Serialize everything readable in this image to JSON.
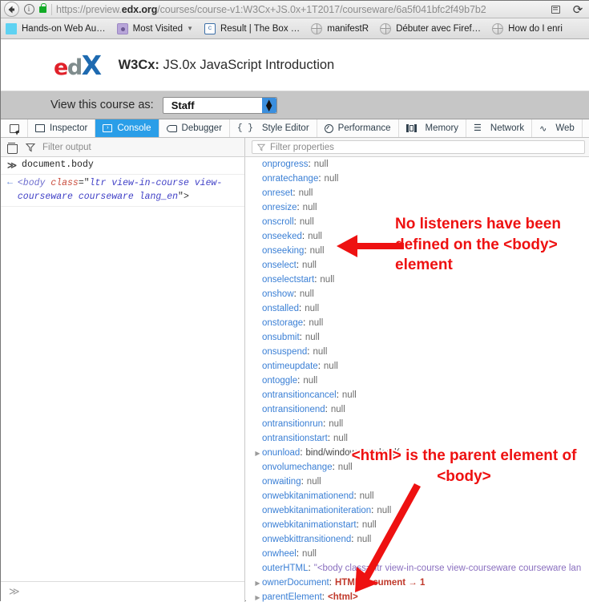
{
  "browser": {
    "url_prefix": "https://preview.",
    "url_domain": "edx.org",
    "url_rest": "/courses/course-v1:W3Cx+JS.0x+1T2017/courseware/6a5f041bfc2f49b7b2",
    "back_icon": "back-arrow-icon",
    "info_icon": "info-icon",
    "lock_icon": "secure-lock-icon",
    "reader_icon": "reader-mode-icon",
    "reload_icon": "reload-icon",
    "reload_glyph": "⟳",
    "info_glyph": "i"
  },
  "bookmarks": [
    {
      "label": "Hands-on Web Au…",
      "icon": "blue-square-icon",
      "has_caret": false
    },
    {
      "label": "Most Visited",
      "icon": "folder-icon",
      "has_caret": true
    },
    {
      "label": "Result | The Box …",
      "icon": "codepen-icon",
      "has_caret": false
    },
    {
      "label": "manifestR",
      "icon": "globe-icon",
      "has_caret": false
    },
    {
      "label": "Débuter avec Firef…",
      "icon": "globe-icon",
      "has_caret": false
    },
    {
      "label": "How do I enri",
      "icon": "globe-icon",
      "has_caret": false
    }
  ],
  "edx": {
    "logo_e": "e",
    "logo_d": "d",
    "logo_x": "X",
    "course_code": "W3Cx:",
    "course_name": " JS.0x JavaScript Introduction"
  },
  "viewas": {
    "label": "View this course as:",
    "selected": "Staff",
    "up_glyph": "▲",
    "down_glyph": "▼"
  },
  "devtools": {
    "picker_icon": "element-picker-icon",
    "tabs": [
      {
        "label": "Inspector",
        "icon": "inspector-icon",
        "active": false
      },
      {
        "label": "Console",
        "icon": "console-icon",
        "active": true
      },
      {
        "label": "Debugger",
        "icon": "debugger-icon",
        "active": false
      },
      {
        "label": "Style Editor",
        "icon": "style-editor-icon",
        "active": false
      },
      {
        "label": "Performance",
        "icon": "performance-icon",
        "active": false
      },
      {
        "label": "Memory",
        "icon": "memory-icon",
        "active": false
      },
      {
        "label": "Network",
        "icon": "network-icon",
        "active": false
      },
      {
        "label": "Web",
        "icon": "web-audio-icon",
        "active": false
      }
    ],
    "style_editor_glyph": "{ }",
    "network_glyph": "☰",
    "audio_glyph": "∿",
    "console_glyph": "›",
    "clear_icon": "trash-icon",
    "filter_output_placeholder": "Filter output",
    "filter_properties_placeholder": "Filter properties"
  },
  "console": {
    "input_marker": "≫",
    "input_text": "document.body",
    "output_marker": "←",
    "output_tag_open": "<body ",
    "output_attr": "class",
    "output_eq": "=\"",
    "output_value": "ltr view-in-course view-courseware courseware  lang_en",
    "output_tag_close": "\">",
    "prompt_marker": "≫"
  },
  "properties": [
    {
      "name": "onprogress",
      "value": "null",
      "kind": "null",
      "expandable": false
    },
    {
      "name": "onratechange",
      "value": "null",
      "kind": "null",
      "expandable": false
    },
    {
      "name": "onreset",
      "value": "null",
      "kind": "null",
      "expandable": false
    },
    {
      "name": "onresize",
      "value": "null",
      "kind": "null",
      "expandable": false
    },
    {
      "name": "onscroll",
      "value": "null",
      "kind": "null",
      "expandable": false
    },
    {
      "name": "onseeked",
      "value": "null",
      "kind": "null",
      "expandable": false
    },
    {
      "name": "onseeking",
      "value": "null",
      "kind": "null",
      "expandable": false
    },
    {
      "name": "onselect",
      "value": "null",
      "kind": "null",
      "expandable": false
    },
    {
      "name": "onselectstart",
      "value": "null",
      "kind": "null",
      "expandable": false
    },
    {
      "name": "onshow",
      "value": "null",
      "kind": "null",
      "expandable": false
    },
    {
      "name": "onstalled",
      "value": "null",
      "kind": "null",
      "expandable": false
    },
    {
      "name": "onstorage",
      "value": "null",
      "kind": "null",
      "expandable": false
    },
    {
      "name": "onsubmit",
      "value": "null",
      "kind": "null",
      "expandable": false
    },
    {
      "name": "onsuspend",
      "value": "null",
      "kind": "null",
      "expandable": false
    },
    {
      "name": "ontimeupdate",
      "value": "null",
      "kind": "null",
      "expandable": false
    },
    {
      "name": "ontoggle",
      "value": "null",
      "kind": "null",
      "expandable": false
    },
    {
      "name": "ontransitioncancel",
      "value": "null",
      "kind": "null",
      "expandable": false
    },
    {
      "name": "ontransitionend",
      "value": "null",
      "kind": "null",
      "expandable": false
    },
    {
      "name": "ontransitionrun",
      "value": "null",
      "kind": "null",
      "expandable": false
    },
    {
      "name": "ontransitionstart",
      "value": "null",
      "kind": "null",
      "expandable": false
    },
    {
      "name": "onunload",
      "value": "bind/window.onunload(",
      "kind": "fn",
      "expandable": true
    },
    {
      "name": "onvolumechange",
      "value": "null",
      "kind": "null",
      "expandable": false
    },
    {
      "name": "onwaiting",
      "value": "null",
      "kind": "null",
      "expandable": false
    },
    {
      "name": "onwebkitanimationend",
      "value": "null",
      "kind": "null",
      "expandable": false
    },
    {
      "name": "onwebkitanimationiteration",
      "value": "null",
      "kind": "null",
      "expandable": false
    },
    {
      "name": "onwebkitanimationstart",
      "value": "null",
      "kind": "null",
      "expandable": false
    },
    {
      "name": "onwebkittransitionend",
      "value": "null",
      "kind": "null",
      "expandable": false
    },
    {
      "name": "onwheel",
      "value": "null",
      "kind": "null",
      "expandable": false
    },
    {
      "name": "outerHTML",
      "value": "\"<body class=\"ltr view-in-course view-courseware courseware  lan",
      "kind": "str",
      "expandable": false
    },
    {
      "name": "ownerDocument",
      "value": "HTMLDocument → 1",
      "kind": "obj",
      "expandable": true
    },
    {
      "name": "parentElement",
      "value": "<html>",
      "kind": "tag",
      "expandable": true
    }
  ],
  "annotations": [
    {
      "id": "annotation-no-listeners",
      "text": "No listeners have been defined on the <body> element",
      "color": "#ee1111"
    },
    {
      "id": "annotation-parent-element",
      "text": "<html> is the parent element of <body>",
      "color": "#ee1111"
    }
  ]
}
